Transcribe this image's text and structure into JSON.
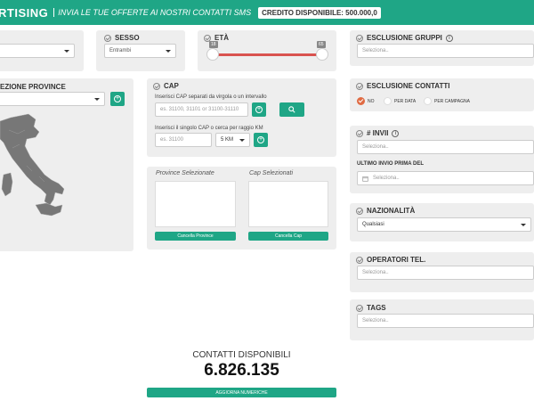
{
  "header": {
    "brand": "RTISING",
    "tagline": "INVIA LE TUE OFFERTE AI NOSTRI CONTATTI SMS",
    "credit": "CREDITO DISPONIBILE: 500.000,0"
  },
  "sesso": {
    "title": "SESSO",
    "value": "Entrambi"
  },
  "eta": {
    "title": "ETÀ",
    "min_label": "18",
    "max_label": "65"
  },
  "esclusione_gruppi": {
    "title": "ESCLUSIONE GRUPPI",
    "placeholder": "Seleziona.."
  },
  "province": {
    "title": "EZIONE PROVINCE"
  },
  "cap": {
    "title": "CAP",
    "hint1": "Inserisci CAP separati da virgola o un intervallo",
    "placeholder1": "es. 31100, 31101 or 31100-31110",
    "hint2": "Inserisci il singolo CAP o cerca per raggio KM",
    "placeholder2": "es. 31100",
    "km_value": "5 KM"
  },
  "selected": {
    "province_title": "Province Selezionate",
    "cap_title": "Cap Selezionati",
    "clear_province": "Cancella Province",
    "clear_cap": "Cancella Cap"
  },
  "esclusione_contatti": {
    "title": "ESCLUSIONE CONTATTI",
    "options": [
      "NO",
      "PER DATA",
      "PER CAMPAGNA"
    ]
  },
  "invii": {
    "title": "# INVII",
    "placeholder": "Seleziona..",
    "ultimo_label": "ULTIMO INVIO PRIMA DEL",
    "ultimo_placeholder": "Seleziona.."
  },
  "nazionalita": {
    "title": "NAZIONALITÀ",
    "value": "Qualsiasi"
  },
  "operatori": {
    "title": "OPERATORI TEL.",
    "placeholder": "Seleziona.."
  },
  "tags": {
    "title": "TAGS",
    "placeholder": "Seleziona.."
  },
  "contatti": {
    "label": "CONTATTI DISPONIBILI",
    "count": "6.826.135",
    "update_button": "AGGIORNA NUMERICHE"
  },
  "colors": {
    "accent": "#1fa686",
    "slider": "#d9534f",
    "radio_on": "#e06b43"
  }
}
